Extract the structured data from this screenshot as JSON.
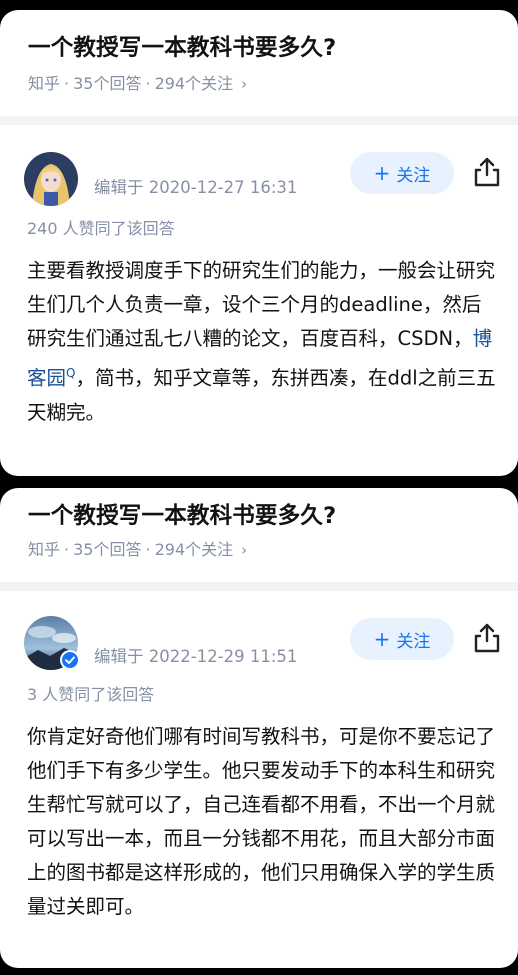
{
  "cards": [
    {
      "question": {
        "title": "一个教授写一本教科书要多久?",
        "source": "知乎",
        "answers": "35个回答",
        "followers": "294个关注",
        "chevron": "›"
      },
      "author": {
        "avatar_icon": "anime-avatar",
        "edited": "编辑于 2020-12-27 16:31"
      },
      "follow_label": "关注",
      "agree": "240 人赞同了该回答",
      "body": {
        "before_link": "主要看教授调度手下的研究生们的能力，一般会让研究生们几个人负责一章，设个三个月的deadline，然后研究生们通过乱七八糟的论文，百度百科，CSDN，",
        "link": "博客园",
        "link_mark": "Q",
        "after_link": "，简书，知乎文章等，东拼西凑，在ddl之前三五天糊完。"
      }
    },
    {
      "question": {
        "title": "一个教授写一本教科书要多久?",
        "source": "知乎",
        "answers": "35个回答",
        "followers": "294个关注",
        "chevron": "›"
      },
      "author": {
        "avatar_icon": "landscape-avatar",
        "verified_icon": "verified-check-icon",
        "edited": "编辑于 2022-12-29 11:51"
      },
      "follow_label": "关注",
      "agree": "3 人赞同了该回答",
      "body": {
        "text": "你肯定好奇他们哪有时间写教科书，可是你不要忘记了他们手下有多少学生。他只要发动手下的本科生和研究生帮忙写就可以了，自己连看都不用看，不出一个月就可以写出一本，而且一分钱都不用花，而且大部分市面上的图书都是这样形成的，他们只用确保入学的学生质量过关即可。"
      }
    }
  ],
  "colors": {
    "brand": "#1772f6",
    "meta": "#8590a6",
    "link": "#175199",
    "follow_bg": "#e8f2ff"
  },
  "icons": {
    "share": "share-icon",
    "plus": "plus-icon",
    "chevron": "chevron-right-icon"
  }
}
